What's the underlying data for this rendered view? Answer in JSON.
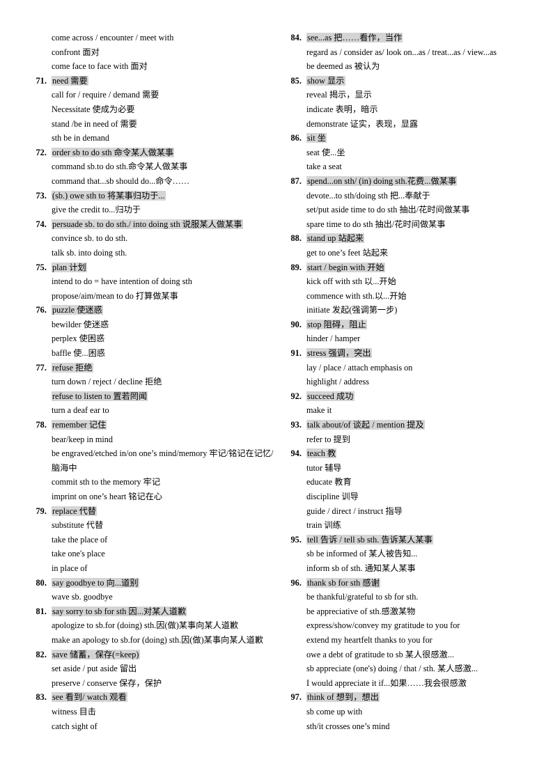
{
  "document": {
    "type": "vocabulary-synonym-list",
    "highlight_color": "#d4d4d4",
    "text_color": "#000000",
    "background_color": "#ffffff"
  },
  "columns": [
    {
      "name": "left-column",
      "orphan_lines": [
        {
          "text": "come across / encounter / meet with",
          "highlighted": false
        },
        {
          "text": "confront 面对",
          "highlighted": false
        },
        {
          "text": "come face to face with 面对",
          "highlighted": false
        }
      ],
      "entries": [
        {
          "number": "71.",
          "lines": [
            {
              "text": "need 需要",
              "highlighted": true
            },
            {
              "text": "call for / require / demand  需要",
              "highlighted": false
            },
            {
              "text": "Necessitate  使成为必要",
              "highlighted": false
            },
            {
              "text": "stand /be in need of 需要",
              "highlighted": false
            },
            {
              "text": "sth be in demand",
              "highlighted": false
            }
          ]
        },
        {
          "number": "72.",
          "lines": [
            {
              "text": "order sb to do sth 命令某人做某事",
              "highlighted": true
            },
            {
              "text": "command sb.to do sth.命令某人做某事",
              "highlighted": false
            },
            {
              "text": "command that...sb should do...命令……",
              "highlighted": false
            }
          ]
        },
        {
          "number": "73.",
          "lines": [
            {
              "text": "(sb.) owe sth to 将某事归功于...",
              "highlighted": true
            },
            {
              "text": "give the credit to...归功于",
              "highlighted": false
            }
          ]
        },
        {
          "number": "74.",
          "lines": [
            {
              "text": "persuade sb. to do sth./ into doing sth 说服某人做某事",
              "highlighted": true
            },
            {
              "text": "convince sb. to do sth.",
              "highlighted": false
            },
            {
              "text": "talk sb. into doing sth.",
              "highlighted": false
            }
          ]
        },
        {
          "number": "75.",
          "lines": [
            {
              "text": "plan 计划",
              "highlighted": true
            },
            {
              "text": "intend to do = have intention of doing sth",
              "highlighted": false
            },
            {
              "text": "propose/aim/mean  to do 打算做某事",
              "highlighted": false
            }
          ]
        },
        {
          "number": "76.",
          "lines": [
            {
              "text": "puzzle 使迷惑",
              "highlighted": true
            },
            {
              "text": "bewilder 使迷惑",
              "highlighted": false
            },
            {
              "text": "perplex 使困惑",
              "highlighted": false
            },
            {
              "text": "baffle 使...困惑",
              "highlighted": false
            }
          ]
        },
        {
          "number": "77.",
          "lines": [
            {
              "text": "refuse 拒绝",
              "highlighted": true
            },
            {
              "text": "turn down / reject / decline 拒绝",
              "highlighted": false
            },
            {
              "text": "refuse to listen to 置若罔闻",
              "highlighted": true
            },
            {
              "text": "turn a deaf ear to",
              "highlighted": false
            }
          ]
        },
        {
          "number": "78.",
          "lines": [
            {
              "text": "remember  记住",
              "highlighted": true
            },
            {
              "text": "bear/keep in mind",
              "highlighted": false
            },
            {
              "text": "be engraved/etched in/on one’s mind/memory 牢记/铭记在记忆/脑海中",
              "highlighted": false
            },
            {
              "text": "commit sth to the memory 牢记",
              "highlighted": false
            },
            {
              "text": "imprint on one’s heart 铭记在心",
              "highlighted": false
            }
          ]
        },
        {
          "number": "79.",
          "lines": [
            {
              "text": "replace  代替",
              "highlighted": true
            },
            {
              "text": "substitute  代替",
              "highlighted": false
            },
            {
              "text": "take the place of",
              "highlighted": false
            },
            {
              "text": "take one's place",
              "highlighted": false
            },
            {
              "text": "in place of",
              "highlighted": false
            }
          ]
        },
        {
          "number": "80.",
          "lines": [
            {
              "text": "say goodbye to 向...道别",
              "highlighted": true
            },
            {
              "text": "wave sb. goodbye",
              "highlighted": false
            }
          ]
        },
        {
          "number": "81.",
          "lines": [
            {
              "text": "say sorry to sb for sth 因...对某人道歉",
              "highlighted": true
            },
            {
              "text": "apologize to sb.for (doing) sth.因(做)某事向某人道歉",
              "highlighted": false
            },
            {
              "text": "make an apology to sb.for (doing) sth.因(做)某事向某人道歉",
              "highlighted": false
            }
          ]
        },
        {
          "number": "82.",
          "lines": [
            {
              "text": "save 储蓄，保存(=keep)",
              "highlighted": true
            },
            {
              "text": "set aside / put aside 留出",
              "highlighted": false
            },
            {
              "text": "preserve / conserve 保存，保护",
              "highlighted": false
            }
          ]
        },
        {
          "number": "83.",
          "lines": [
            {
              "text": "see 看到/ watch 观看",
              "highlighted": true
            },
            {
              "text": "witness 目击",
              "highlighted": false
            },
            {
              "text": "catch sight of",
              "highlighted": false
            }
          ]
        }
      ]
    },
    {
      "name": "right-column",
      "orphan_lines": [],
      "entries": [
        {
          "number": "84.",
          "lines": [
            {
              "text": "see...as 把……看作，当作",
              "highlighted": true
            },
            {
              "text": "regard as / consider as/ look on...as / treat...as / view...as",
              "highlighted": false
            },
            {
              "text": "be deemed as 被认为",
              "highlighted": false
            }
          ]
        },
        {
          "number": "85.",
          "lines": [
            {
              "text": "show 显示",
              "highlighted": true
            },
            {
              "text": "reveal 揭示，显示",
              "highlighted": false
            },
            {
              "text": "indicate 表明，暗示",
              "highlighted": false
            },
            {
              "text": "demonstrate 证实，表现，显露",
              "highlighted": false
            }
          ]
        },
        {
          "number": "86.",
          "lines": [
            {
              "text": "sit 坐",
              "highlighted": true
            },
            {
              "text": "seat 使...坐",
              "highlighted": false
            },
            {
              "text": "take a seat",
              "highlighted": false
            }
          ]
        },
        {
          "number": "87.",
          "lines": [
            {
              "text": "spend...on sth/ (in) doing sth.花费...做某事",
              "highlighted": true
            },
            {
              "text": "devote...to sth/doing sth   把...奉献于",
              "highlighted": false
            },
            {
              "text": "set/put aside time to do sth 抽出/花时间做某事",
              "highlighted": false
            },
            {
              "text": "spare time to do sth 抽出/花时间做某事",
              "highlighted": false
            }
          ]
        },
        {
          "number": "88.",
          "lines": [
            {
              "text": "stand up 站起来",
              "highlighted": true
            },
            {
              "text": "get to one’s feet 站起来",
              "highlighted": false
            }
          ]
        },
        {
          "number": "89.",
          "lines": [
            {
              "text": "start / begin with 开始",
              "highlighted": true
            },
            {
              "text": "kick off with sth 以...开始",
              "highlighted": false
            },
            {
              "text": "commence with sth.以...开始",
              "highlighted": false
            },
            {
              "text": "initiate 发起(强调第一步)",
              "highlighted": false
            }
          ]
        },
        {
          "number": "90.",
          "lines": [
            {
              "text": "stop 阻碍，阻止",
              "highlighted": true
            },
            {
              "text": "hinder / hamper",
              "highlighted": false
            }
          ]
        },
        {
          "number": "91.",
          "lines": [
            {
              "text": "stress 强调，突出",
              "highlighted": true
            },
            {
              "text": "lay / place / attach emphasis on",
              "highlighted": false
            },
            {
              "text": "highlight / address",
              "highlighted": false
            }
          ]
        },
        {
          "number": "92.",
          "lines": [
            {
              "text": "succeed 成功",
              "highlighted": true
            },
            {
              "text": "make it",
              "highlighted": false
            }
          ]
        },
        {
          "number": "93.",
          "lines": [
            {
              "text": "talk about/of  谈起 / mention 提及",
              "highlighted": true
            },
            {
              "text": "refer to  提到",
              "highlighted": false
            }
          ]
        },
        {
          "number": "94.",
          "lines": [
            {
              "text": "teach 教",
              "highlighted": true
            },
            {
              "text": "tutor 辅导",
              "highlighted": false
            },
            {
              "text": "educate 教育",
              "highlighted": false
            },
            {
              "text": "discipline 训导",
              "highlighted": false
            },
            {
              "text": "guide / direct / instruct 指导",
              "highlighted": false
            },
            {
              "text": "train 训练",
              "highlighted": false
            }
          ]
        },
        {
          "number": "95.",
          "lines": [
            {
              "text": "tell  告诉 / tell sb sth.  告诉某人某事",
              "highlighted": true
            },
            {
              "text": "sb be informed of  某人被告知...",
              "highlighted": false
            },
            {
              "text": "inform sb of sth.  通知某人某事",
              "highlighted": false
            }
          ]
        },
        {
          "number": "96.",
          "lines": [
            {
              "text": "thank sb for sth  感谢",
              "highlighted": true
            },
            {
              "text": "be thankful/grateful  to sb for sth.",
              "highlighted": false
            },
            {
              "text": "be appreciative  of sth.感激某物",
              "highlighted": false
            },
            {
              "text": "express/show/convey my gratitude  to you for",
              "highlighted": false
            },
            {
              "text": "extend my heartfelt  thanks to you for",
              "highlighted": false
            },
            {
              "text": "owe a debt of gratitude  to sb 某人很感激...",
              "highlighted": false
            },
            {
              "text": "sb appreciate  (one's) doing / that / sth.  某人感激...",
              "highlighted": false
            },
            {
              "text": "I would appreciate  it if...如果……我会很感激",
              "highlighted": false
            }
          ]
        },
        {
          "number": "97.",
          "lines": [
            {
              "text": "think of 想到，想出",
              "highlighted": true
            },
            {
              "text": "sb come up with",
              "highlighted": false
            },
            {
              "text": "sth/it crosses one’s mind",
              "highlighted": false
            }
          ]
        }
      ]
    }
  ]
}
